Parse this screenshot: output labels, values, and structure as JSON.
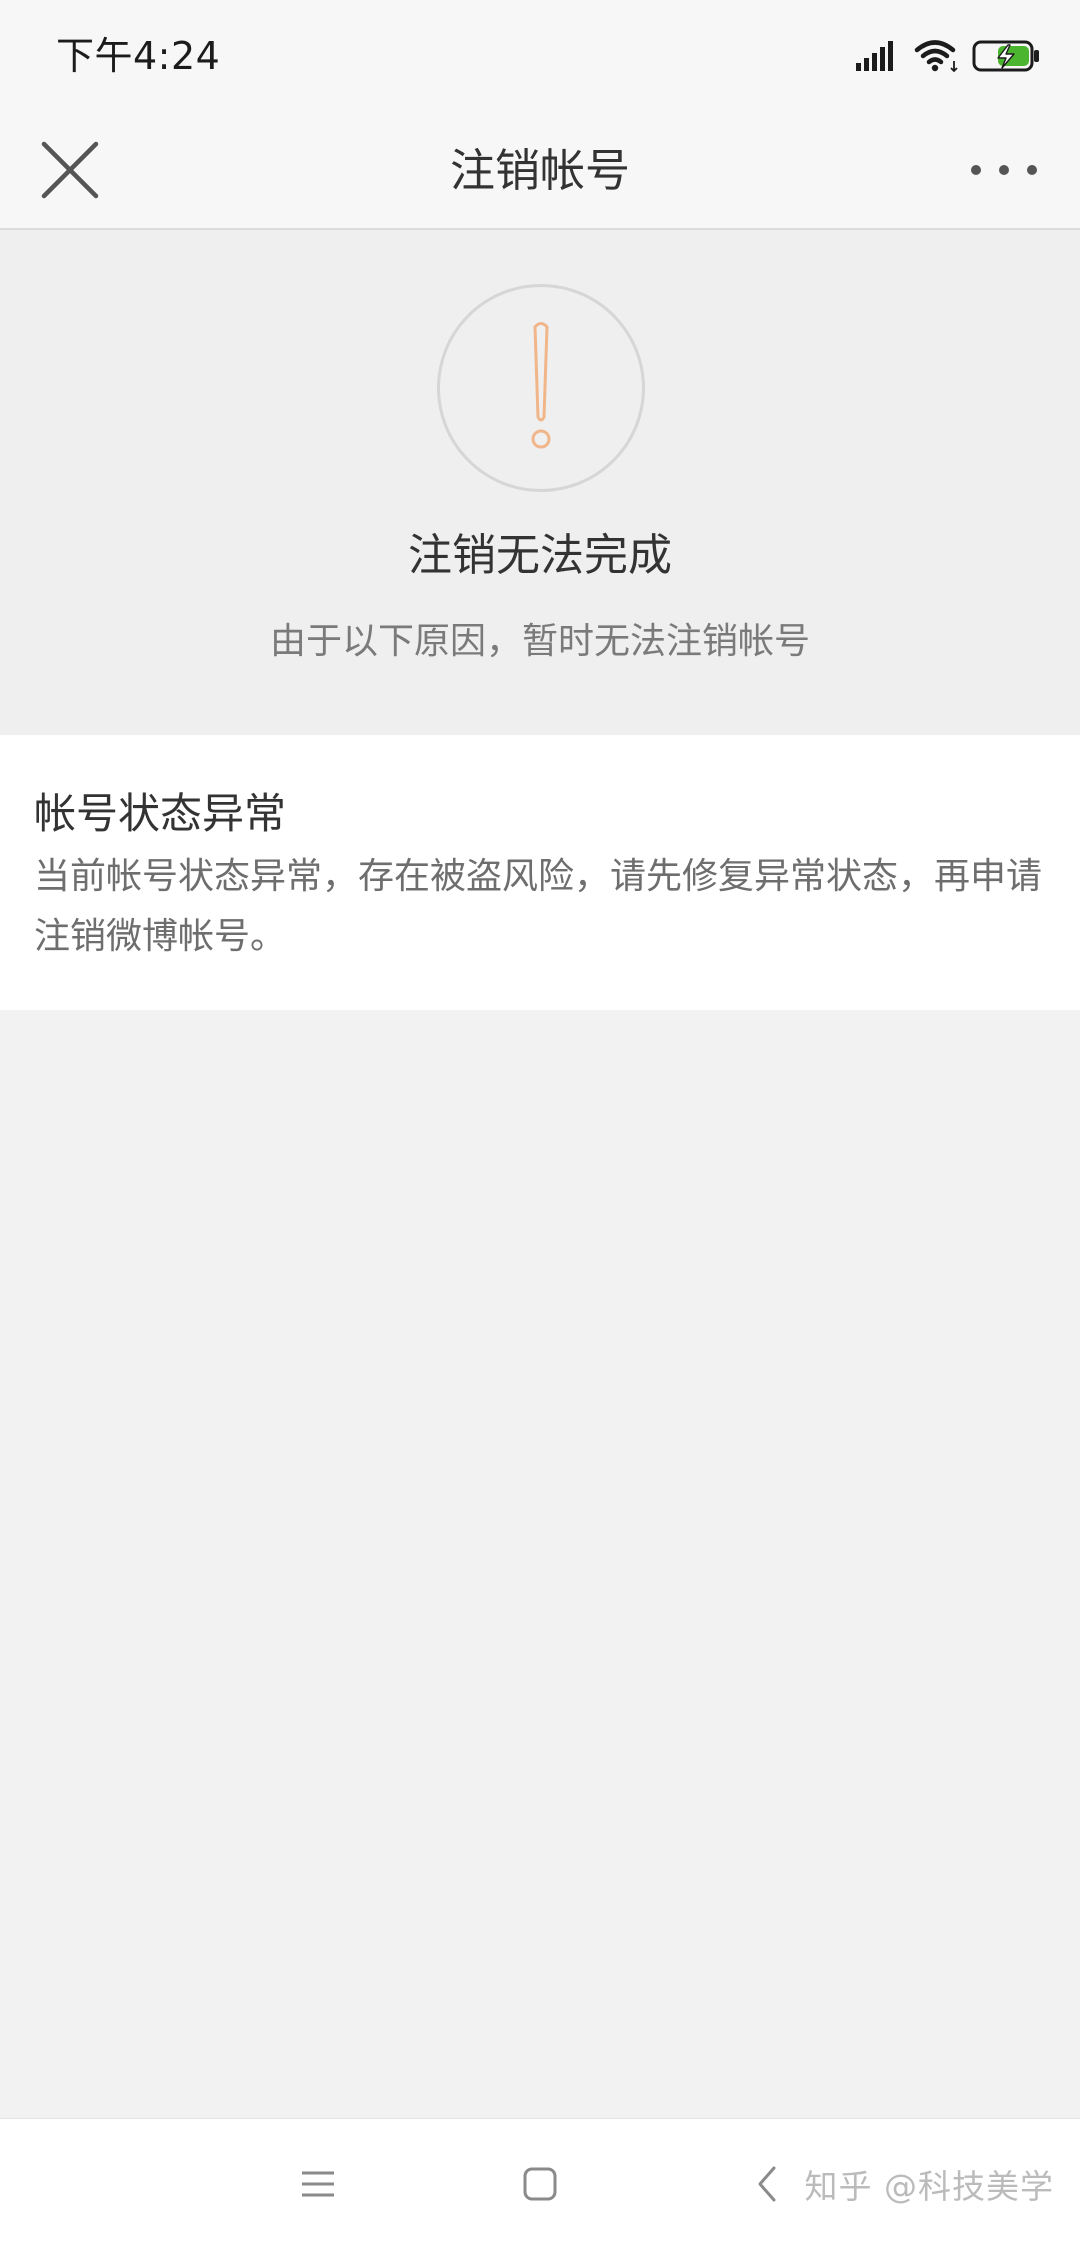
{
  "status_bar": {
    "time": "下午4:24",
    "icons": [
      "signal-icon",
      "wifi-icon",
      "battery-charging-icon"
    ],
    "battery_color": "#4cb52f"
  },
  "nav": {
    "title": "注销帐号",
    "close_icon": "close-icon",
    "more_icon": "more-icon"
  },
  "error": {
    "icon": "warning-icon",
    "icon_color": "#f0b589",
    "title": "注销无法完成",
    "subtitle": "由于以下原因，暂时无法注销帐号"
  },
  "reason": {
    "title": "帐号状态异常",
    "description": "当前帐号状态异常，存在被盗风险，请先修复异常状态，再申请注销微博帐号。"
  },
  "system_nav": {
    "buttons": [
      "menu-icon",
      "home-icon",
      "back-icon"
    ]
  },
  "watermark": "知乎 @科技美学"
}
